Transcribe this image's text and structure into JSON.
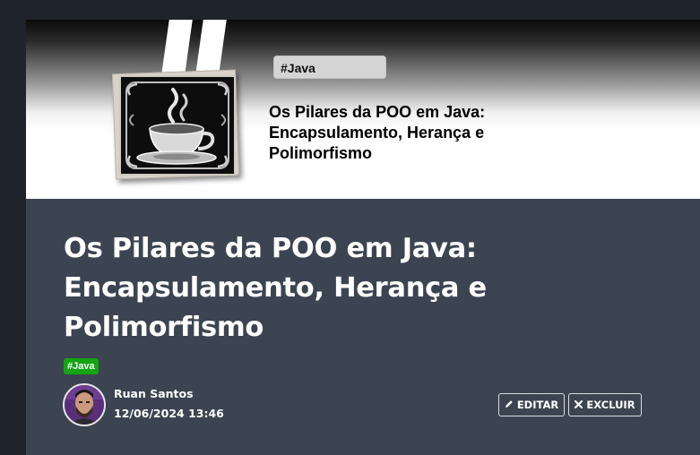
{
  "banner": {
    "tag": "#Java",
    "title": "Os Pilares da POO em Java: Encapsulamento, Herança e Polimorfismo",
    "logo_icon": "coffee-cup-icon"
  },
  "post": {
    "title": "Os Pilares da POO em Java: Encapsulamento, Herança e Polimorfismo",
    "tag": "#Java",
    "tag_color": "#14a314",
    "background_color": "#3b4450"
  },
  "author": {
    "name": "Ruan Santos",
    "date": "12/06/2024 13:46",
    "avatar_icon": "user-avatar"
  },
  "actions": {
    "edit_label": "EDITAR",
    "edit_icon": "pencil-icon",
    "delete_label": "EXCLUIR",
    "delete_icon": "close-icon"
  }
}
